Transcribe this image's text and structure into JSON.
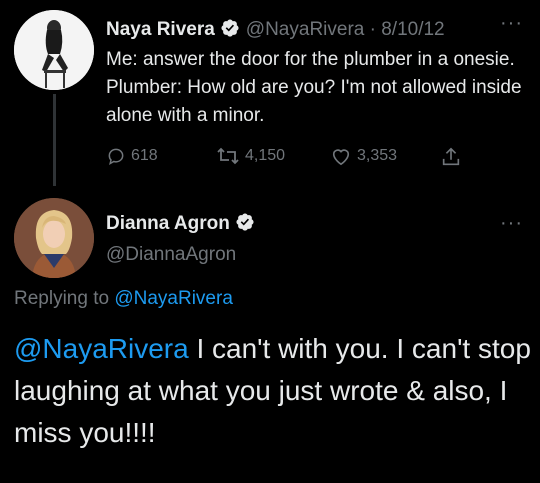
{
  "tweet1": {
    "name": "Naya Rivera",
    "handle": "@NayaRivera",
    "separator": " · ",
    "date": "8/10/12",
    "text": "Me: answer the door for the plumber in a onesie. Plumber: How old are you? I'm not allowed inside alone with a minor.",
    "stats": {
      "replies": "618",
      "retweets": "4,150",
      "likes": "3,353"
    },
    "icons": [
      "reply-icon",
      "retweet-icon",
      "like-icon",
      "share-icon",
      "verified-badge-icon",
      "more-options-icon"
    ]
  },
  "tweet2": {
    "name": "Dianna Agron",
    "handle": "@DiannaAgron",
    "replying_prefix": "Replying to ",
    "replying_handle": "@NayaRivera",
    "mention": "@NayaRivera",
    "text": " I can't with you. I can't stop laughing at what you just wrote & also, I miss you!!!!"
  },
  "colors": {
    "background": "#000000",
    "text": "#e7e9ea",
    "secondary": "#71767b",
    "link": "#1d9bf0",
    "verified": "#e7e9ea"
  }
}
